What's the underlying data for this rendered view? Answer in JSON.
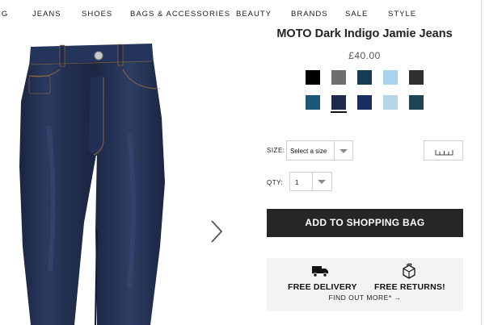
{
  "nav": {
    "items": [
      "NG",
      "JEANS",
      "SHOES",
      "BAGS & ACCESSORIES",
      "BEAUTY",
      "BRANDS",
      "SALE",
      "STYLE"
    ]
  },
  "product": {
    "title": "MOTO Dark Indigo Jamie Jeans",
    "price": "£40.00",
    "swatches": [
      {
        "color": "#000000",
        "selected": false
      },
      {
        "color": "#6e6e6e",
        "selected": false
      },
      {
        "color": "#153b55",
        "selected": false
      },
      {
        "color": "#a9d3ec",
        "selected": false
      },
      {
        "color": "#2f2f2f",
        "selected": false
      },
      {
        "color": "#1d5878",
        "selected": false
      },
      {
        "color": "#1f2b4d",
        "selected": true
      },
      {
        "color": "#192d5e",
        "selected": false
      },
      {
        "color": "#b7d5e6",
        "selected": false
      },
      {
        "color": "#1d4654",
        "selected": false
      }
    ]
  },
  "size": {
    "label": "SIZE:",
    "value": "Select a size",
    "guide_icon": "ruler-icon"
  },
  "qty": {
    "label": "QTY:",
    "value": "1"
  },
  "cart": {
    "add_label": "ADD TO SHOPPING BAG"
  },
  "benefits": {
    "delivery_label": "FREE DELIVERY",
    "delivery_icon": "truck-icon",
    "returns_label": "FREE RETURNS!",
    "returns_icon": "box-return-icon",
    "find_out_label": "FIND OUT MORE* →"
  },
  "icons": {
    "next_image": "chevron-right-icon"
  }
}
